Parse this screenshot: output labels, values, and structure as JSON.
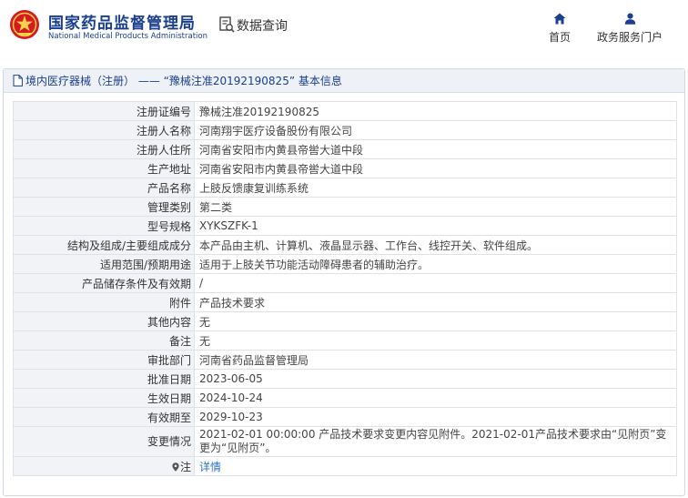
{
  "header": {
    "brand_cn": "国家药品监督管理局",
    "brand_en": "National Medical Products Administration",
    "section_title": "数据查询",
    "nav": [
      {
        "label": "首页",
        "icon": "home-icon"
      },
      {
        "label": "政务服务门户",
        "icon": "user-icon"
      }
    ]
  },
  "panel": {
    "title": "境内医疗器械（注册） —— “豫械注准20192190825” 基本信息"
  },
  "rows": [
    {
      "label": "注册证编号",
      "value": "豫械注准20192190825"
    },
    {
      "label": "注册人名称",
      "value": "河南翔宇医疗设备股份有限公司"
    },
    {
      "label": "注册人住所",
      "value": "河南省安阳市内黄县帝喾大道中段"
    },
    {
      "label": "生产地址",
      "value": "河南省安阳市内黄县帝喾大道中段"
    },
    {
      "label": "产品名称",
      "value": "上肢反馈康复训练系统"
    },
    {
      "label": "管理类别",
      "value": "第二类"
    },
    {
      "label": "型号规格",
      "value": "XYKSZFK-1"
    },
    {
      "label": "结构及组成/主要组成成分",
      "value": "本产品由主机、计算机、液晶显示器、工作台、线控开关、软件组成。"
    },
    {
      "label": "适用范围/预期用途",
      "value": "适用于上肢关节功能活动障碍患者的辅助治疗。"
    },
    {
      "label": "产品储存条件及有效期",
      "value": "/"
    },
    {
      "label": "附件",
      "value": "产品技术要求"
    },
    {
      "label": "其他内容",
      "value": "无"
    },
    {
      "label": "备注",
      "value": "无"
    },
    {
      "label": "审批部门",
      "value": "河南省药品监督管理局"
    },
    {
      "label": "批准日期",
      "value": "2023-06-05"
    },
    {
      "label": "生效日期",
      "value": "2024-10-24"
    },
    {
      "label": "有效期至",
      "value": "2029-10-23"
    },
    {
      "label": "变更情况",
      "value": "2021-02-01 00:00:00 产品技术要求变更内容见附件。2021-02-01产品技术要求由“见附页”变更为“见附页”。"
    }
  ],
  "note": {
    "label": "注",
    "link": "详情"
  },
  "colors": {
    "brand": "#1a3f8f",
    "logo_red": "#d71a21",
    "link": "#2b72c7"
  }
}
